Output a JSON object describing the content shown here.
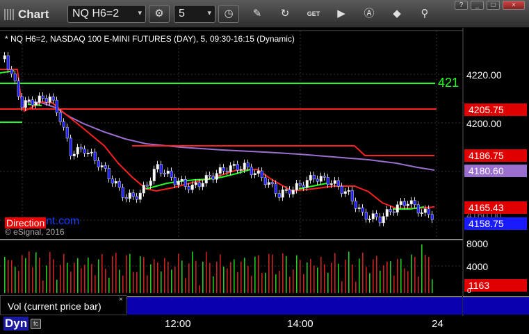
{
  "window": {
    "title": "Chart"
  },
  "toolbar": {
    "symbol": "NQ H6=2",
    "interval": "5",
    "icons": [
      "settings-icon",
      "clock-icon",
      "pencil-icon",
      "refresh-icon",
      "get-icon",
      "play-icon",
      "a-icon",
      "tag-icon",
      "pin-icon"
    ]
  },
  "chart": {
    "description": "* NQ H6=2, NASDAQ 100 E-MINI FUTURES (DAY), 5, 09:30-16:15 (Dynamic)",
    "copyright": "© eSignal, 2016",
    "watermark_a": "Direction",
    "watermark_b": "nt.com",
    "line_label": "421",
    "price_ticks": [
      "4220.00",
      "4200.00"
    ],
    "price_tags": [
      {
        "label": "4205.75",
        "color": "#e00000"
      },
      {
        "label": "4186.75",
        "color": "#e00000"
      },
      {
        "label": "4180.60",
        "color": "#9a6fd0"
      },
      {
        "label": "4165.43",
        "color": "#e00000"
      },
      {
        "label": "4158.75",
        "color": "#1a1aff"
      }
    ],
    "hidden_tick": "4160.00"
  },
  "volume": {
    "label": "Vol (current price bar)",
    "close_symbol": "×",
    "ticks": [
      "8000",
      "4000"
    ],
    "tag": "1163",
    "tag_color": "#e00000",
    "zero": "0"
  },
  "xaxis": {
    "labels": [
      "12:00",
      "14:00",
      "24"
    ]
  },
  "footer": {
    "dyn": "Dyn",
    "fx": "fc"
  }
}
